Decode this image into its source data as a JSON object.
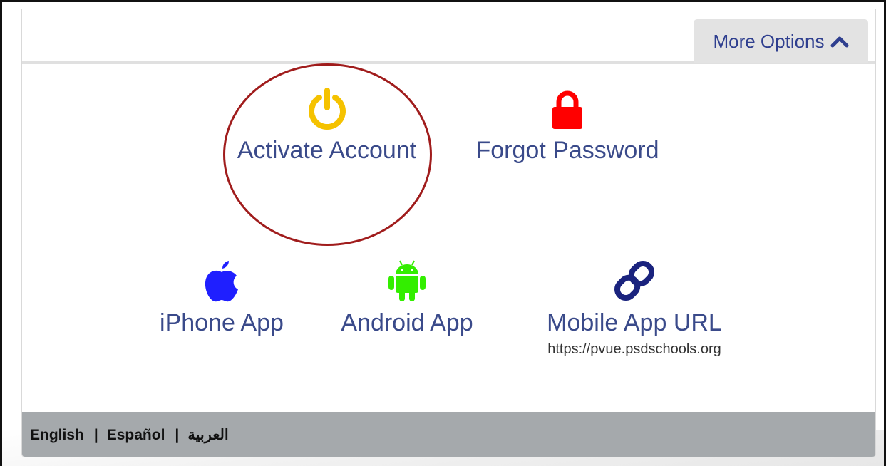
{
  "toolbar": {
    "more_options_label": "More Options"
  },
  "options": {
    "activate": {
      "label": "Activate Account",
      "icon": "power-icon",
      "color": "#f5c200"
    },
    "forgot": {
      "label": "Forgot Password",
      "icon": "lock-icon",
      "color": "#ff0000"
    },
    "iphone": {
      "label": "iPhone App",
      "icon": "apple-icon",
      "color": "#1f1fff"
    },
    "android": {
      "label": "Android App",
      "icon": "android-icon",
      "color": "#33ee00"
    },
    "mobile_url": {
      "label": "Mobile App URL",
      "url": "https://pvue.psdschools.org",
      "icon": "link-icon",
      "color": "#1a237e"
    }
  },
  "footer": {
    "languages": [
      "English",
      "Español",
      "العربية"
    ],
    "separator": "|"
  },
  "annotation": {
    "color": "#a01c1c"
  }
}
